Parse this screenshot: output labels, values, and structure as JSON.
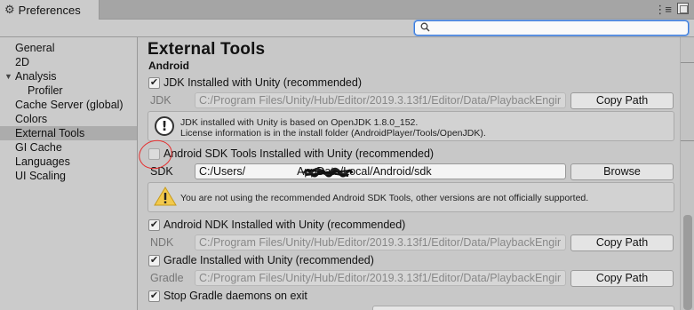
{
  "window": {
    "title": "Preferences",
    "gear_icon": "gear-icon",
    "menu_glyph": "⋮≡",
    "maximize_icon": "maximize-icon"
  },
  "search": {
    "value": "",
    "placeholder": "",
    "icon": "search-icon"
  },
  "sidebar": {
    "items": [
      {
        "label": "General"
      },
      {
        "label": "2D"
      },
      {
        "label": "Analysis",
        "expanded": true
      },
      {
        "label": "Profiler",
        "child": true
      },
      {
        "label": "Cache Server (global)"
      },
      {
        "label": "Colors"
      },
      {
        "label": "External Tools",
        "selected": true
      },
      {
        "label": "GI Cache"
      },
      {
        "label": "Languages"
      },
      {
        "label": "UI Scaling"
      }
    ]
  },
  "main": {
    "title": "External Tools",
    "section": "Android",
    "jdk": {
      "checkbox_label": "JDK Installed with Unity (recommended)",
      "checked": true,
      "field_label": "JDK",
      "path": "C:/Program Files/Unity/Hub/Editor/2019.3.13f1/Editor/Data/PlaybackEngir",
      "button": "Copy Path",
      "info_line1": "JDK installed with Unity is based on OpenJDK 1.8.0_152.",
      "info_line2": "License information is in the install folder (AndroidPlayer/Tools/OpenJDK).",
      "info_glyph": "!"
    },
    "sdk": {
      "checkbox_label": "Android SDK Tools Installed with Unity (recommended)",
      "checked": false,
      "field_label": "SDK",
      "path_prefix": "C:/Users/",
      "path_suffix": "AppData/Local/Android/sdk",
      "button": "Browse",
      "warning": "You are not using the recommended Android SDK Tools, other versions are not officially supported."
    },
    "ndk": {
      "checkbox_label": "Android NDK Installed with Unity (recommended)",
      "checked": true,
      "field_label": "NDK",
      "path": "C:/Program Files/Unity/Hub/Editor/2019.3.13f1/Editor/Data/PlaybackEngir",
      "button": "Copy Path"
    },
    "gradle": {
      "checkbox_label": "Gradle Installed with Unity (recommended)",
      "checked": true,
      "field_label": "Gradle",
      "path": "C:/Program Files/Unity/Hub/Editor/2019.3.13f1/Editor/Data/PlaybackEngir",
      "button": "Copy Path"
    },
    "stop_gradle": {
      "checkbox_label": "Stop Gradle daemons on exit",
      "checked": true
    },
    "check_glyph": "✔"
  },
  "colors": {
    "annotation_red": "#e53030",
    "warning_yellow": "#f2c94c",
    "selection": "#acacac",
    "search_focus": "#3b7ad9"
  }
}
